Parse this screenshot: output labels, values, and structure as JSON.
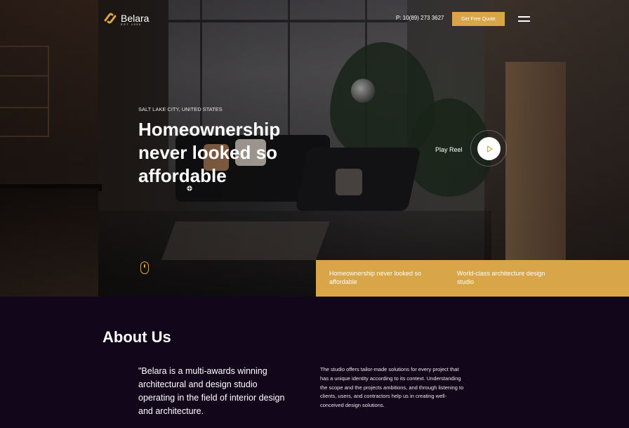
{
  "header": {
    "logo_name": "Belara",
    "logo_est": "EST 1990",
    "phone": "P: 10(89) 273 3627",
    "quote_button": "Get Free Quote",
    "menu_icon": "hamburger-icon"
  },
  "hero": {
    "location": "SALT LAKE CITY, UNITED STATES",
    "headline_line1": "Homeownership",
    "headline_line2": "never looked so",
    "headline_line3": "affordable",
    "play_label": "Play Reel",
    "play_icon": "play-icon",
    "scroll_icon": "mouse-scroll-icon"
  },
  "band": {
    "item1": "Homeownership never looked so affordable",
    "item2": "World-class architecture design studio"
  },
  "about": {
    "title": "About Us",
    "quote": "\"Belara is a multi-awards winning architectural and design studio operating in the field of interior design and architecture.",
    "description": "The studio offers tailor-made solutions for every project that has a unique identity according to its context. Understanding the scope and the projects ambitions, and through listening to clients, users, and contractors help us in creating well-conceived design solutions."
  },
  "colors": {
    "accent": "#d8a548",
    "about_bg": "#12061a"
  }
}
